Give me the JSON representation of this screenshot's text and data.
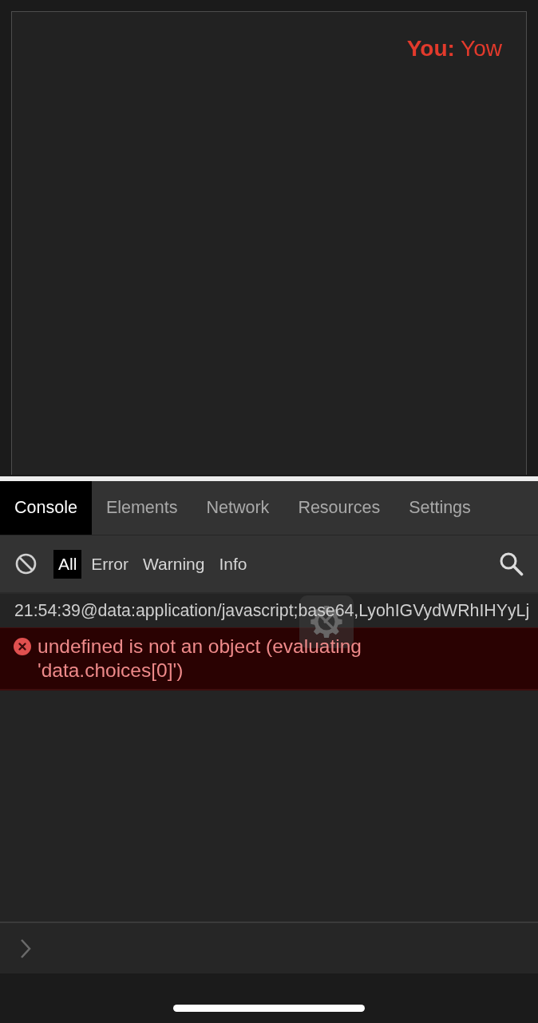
{
  "preview": {
    "text": "**You:** Yow"
  },
  "devtools": {
    "tabs": [
      {
        "label": "Console",
        "selected": true
      },
      {
        "label": "Elements",
        "selected": false
      },
      {
        "label": "Network",
        "selected": false
      },
      {
        "label": "Resources",
        "selected": false
      },
      {
        "label": "Settings",
        "selected": false
      }
    ],
    "filters": [
      {
        "label": "All",
        "selected": true
      },
      {
        "label": "Error",
        "selected": false
      },
      {
        "label": "Warning",
        "selected": false
      },
      {
        "label": "Info",
        "selected": false
      }
    ],
    "logs": [
      {
        "kind": "info",
        "text": "21:54:39@data:application/javascript;base64,LyohIGVydWRhIHYyLj"
      },
      {
        "kind": "error",
        "text": "undefined is not an object (evaluating 'data.choices[0]')"
      }
    ]
  }
}
